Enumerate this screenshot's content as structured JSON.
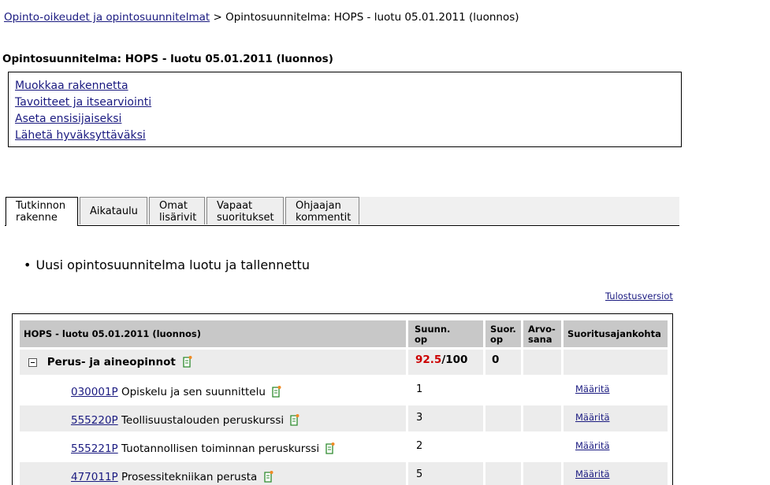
{
  "breadcrumb": {
    "parent_link": "Opinto-oikeudet ja opintosuunnitelmat",
    "separator": ">",
    "current": "Opintosuunnitelma: HOPS - luotu 05.01.2011 (luonnos)"
  },
  "page_title": "Opintosuunnitelma: HOPS - luotu 05.01.2011 (luonnos)",
  "actions": [
    "Muokkaa rakennetta",
    "Tavoitteet ja itsearviointi",
    "Aseta ensisijaiseksi",
    "Lähetä hyväksyttäväksi"
  ],
  "tabs": [
    {
      "line1": "Tutkinnon",
      "line2": "rakenne",
      "active": true
    },
    {
      "line1": "Aikataulu",
      "line2": "",
      "active": false
    },
    {
      "line1": "Omat",
      "line2": "lisärivit",
      "active": false
    },
    {
      "line1": "Vapaat",
      "line2": "suoritukset",
      "active": false
    },
    {
      "line1": "Ohjaajan",
      "line2": "kommentit",
      "active": false
    }
  ],
  "notice": {
    "bullet": "•",
    "text": "Uusi opintosuunnitelma luotu ja tallennettu"
  },
  "print_link": "Tulostusversiot",
  "table": {
    "headers": {
      "name": "HOPS - luotu 05.01.2011 (luonnos)",
      "planned_l1": "Suunn.",
      "planned_l2": "op",
      "done_l1": "Suor.",
      "done_l2": "op",
      "grade_l1": "Arvo-",
      "grade_l2": "sana",
      "date": "Suoritusajankohta"
    },
    "group": {
      "name": "Perus- ja aineopinnot",
      "planned": "92.5",
      "planned_sep": "/",
      "required": "100",
      "done": "0",
      "planned_color": "#cc0000"
    },
    "courses": [
      {
        "code": "030001P",
        "name": "Opiskelu ja sen suunnittelu",
        "credits": "1",
        "action": "Määritä"
      },
      {
        "code": "555220P",
        "name": "Teollisuustalouden peruskurssi",
        "credits": "3",
        "action": "Määritä"
      },
      {
        "code": "555221P",
        "name": "Tuotannollisen toiminnan peruskurssi",
        "credits": "2",
        "action": "Määritä"
      },
      {
        "code": "477011P",
        "name": "Prosessitekniikan perusta",
        "credits": "5",
        "action": "Määritä"
      }
    ]
  }
}
